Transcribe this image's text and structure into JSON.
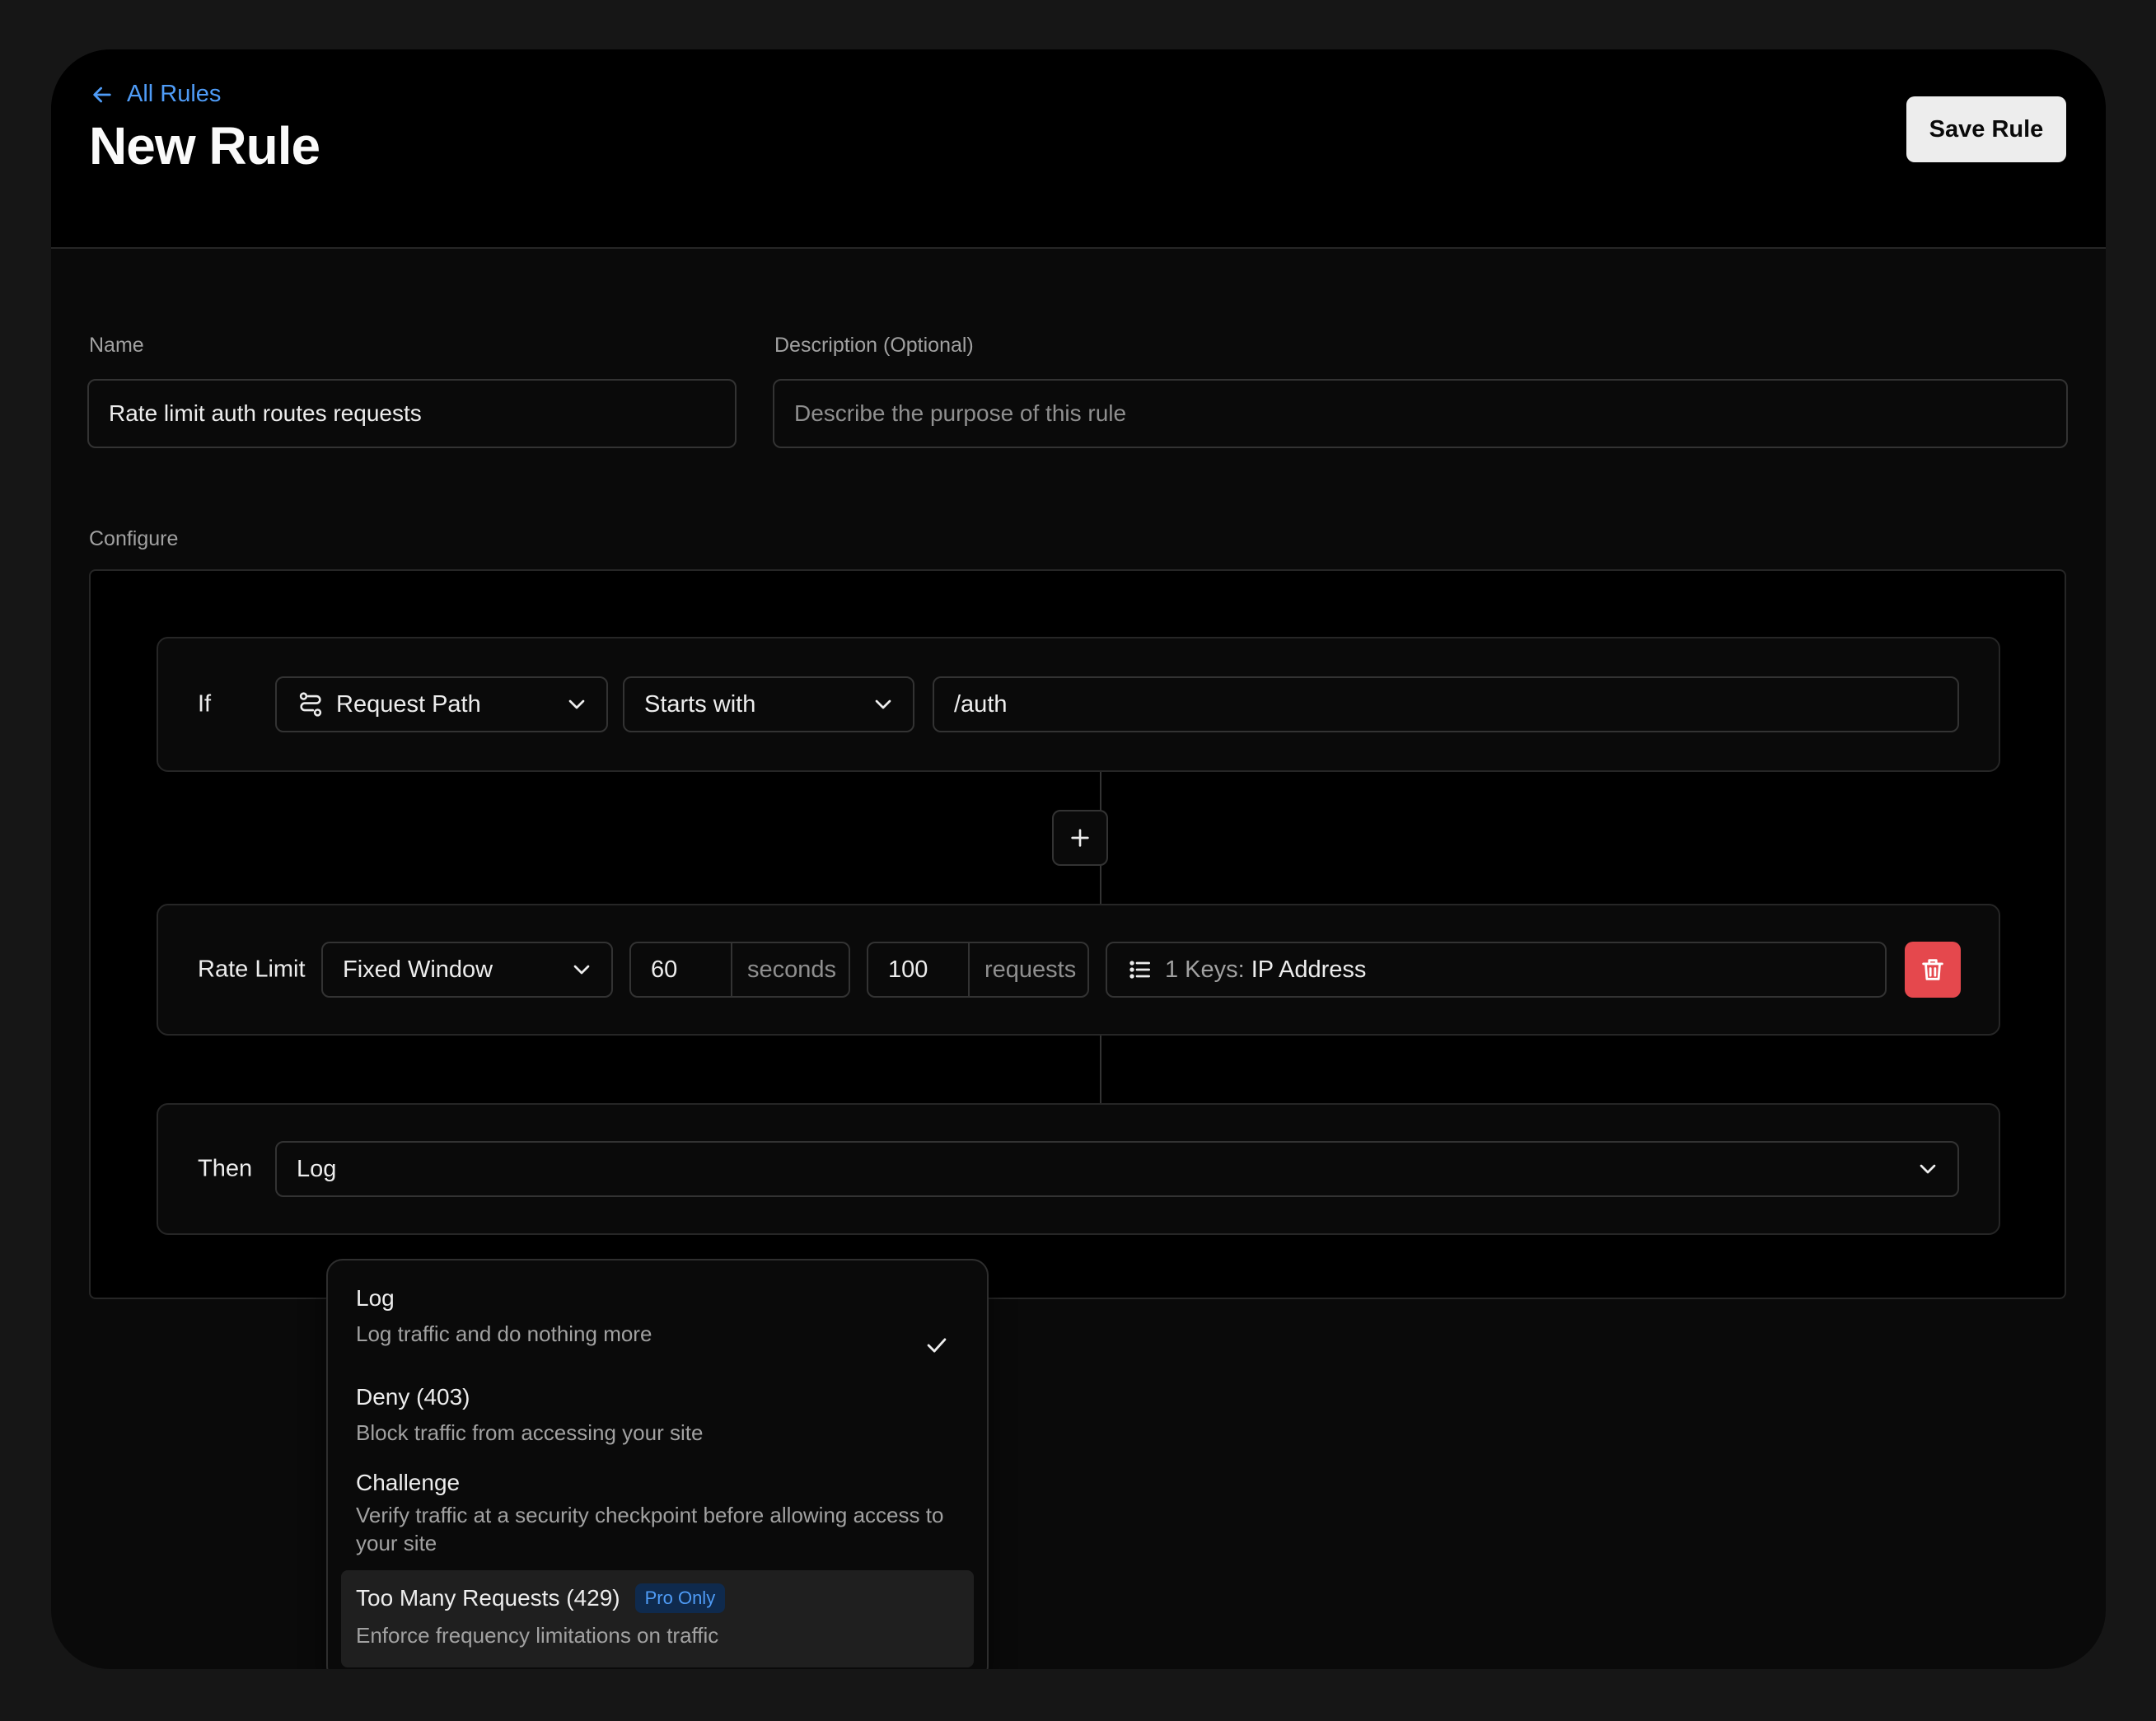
{
  "header": {
    "back_label": "All Rules",
    "title": "New Rule",
    "save_label": "Save Rule"
  },
  "form": {
    "name_label": "Name",
    "name_value": "Rate limit auth routes requests",
    "description_label": "Description (Optional)",
    "description_placeholder": "Describe the purpose of this rule",
    "configure_label": "Configure"
  },
  "condition": {
    "label": "If",
    "field": "Request Path",
    "operator": "Starts with",
    "value": "/auth"
  },
  "rate_limit": {
    "label": "Rate Limit",
    "algorithm": "Fixed Window",
    "window_value": "60",
    "window_unit": "seconds",
    "requests_value": "100",
    "requests_unit": "requests",
    "keys_prefix": "1 Keys:",
    "keys_value": "IP Address"
  },
  "action": {
    "label": "Then",
    "selected": "Log",
    "options": [
      {
        "title": "Log",
        "description": "Log traffic and do nothing more"
      },
      {
        "title": "Deny (403)",
        "description": "Block traffic from accessing your site"
      },
      {
        "title": "Challenge",
        "description": "Verify traffic at a security checkpoint before allowing access to your site"
      },
      {
        "title": "Too Many Requests (429)",
        "badge": "Pro Only",
        "description": "Enforce frequency limitations on traffic"
      }
    ]
  },
  "colors": {
    "accent": "#4f9cf7",
    "danger": "#e5484d",
    "background": "#0a0a0a"
  },
  "icons": [
    "arrow-left-icon",
    "route-icon",
    "chevron-down-icon",
    "plus-icon",
    "list-icon",
    "trash-icon",
    "check-icon"
  ]
}
